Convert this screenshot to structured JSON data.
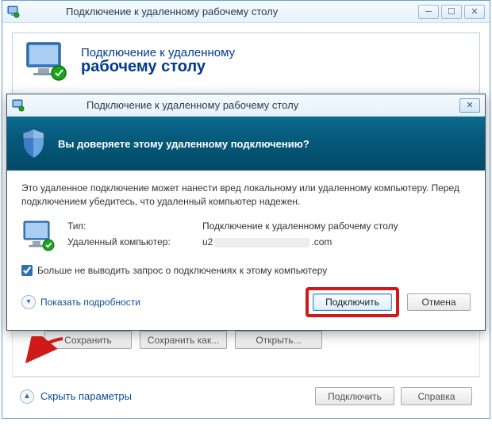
{
  "backWindow": {
    "title": "Подключение к удаленному рабочему столу",
    "banner_line1": "Подключение к удаленному",
    "banner_line2": "рабочему столу",
    "buttons": {
      "save": "Сохранить",
      "save_as": "Сохранить как...",
      "open": "Открыть..."
    },
    "footer": {
      "hide_params": "Скрыть параметры",
      "connect": "Подключить",
      "help": "Справка"
    }
  },
  "dialog": {
    "title": "Подключение к удаленному рабочему столу",
    "question": "Вы доверяете этому удаленному подключению?",
    "warning": "Это удаленное подключение может нанести вред локальному или удаленному компьютеру. Перед подключением убедитесь, что удаленный компьютер надежен.",
    "type_label": "Тип:",
    "type_value": "Подключение к удаленному рабочему столу",
    "remote_label": "Удаленный компьютер:",
    "remote_prefix": "u2",
    "remote_suffix": ".com",
    "checkbox_label": "Больше не выводить запрос о подключениях к этому компьютеру",
    "details": "Показать подробности",
    "connect": "Подключить",
    "cancel": "Отмена"
  }
}
